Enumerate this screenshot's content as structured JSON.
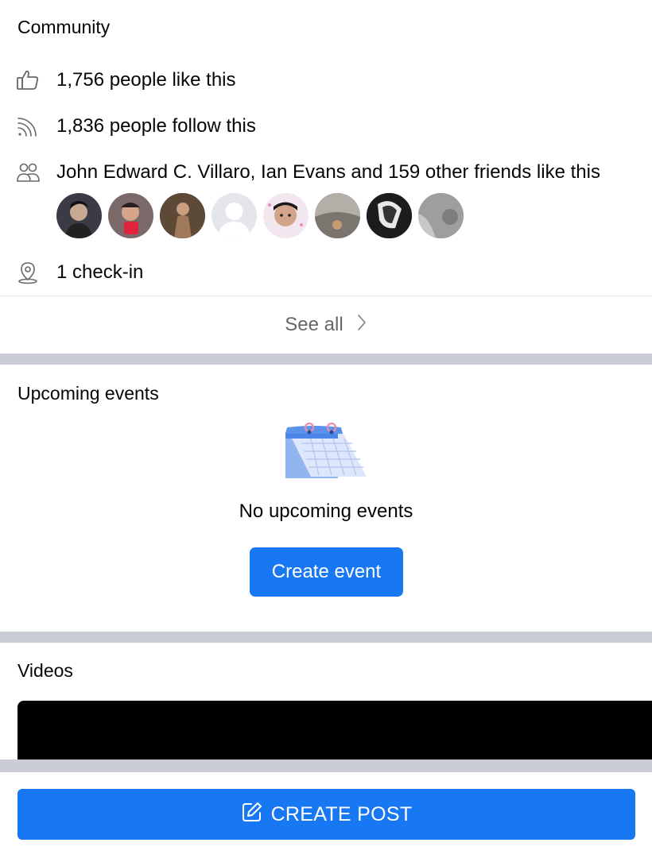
{
  "community": {
    "title": "Community",
    "likes_text": "1,756 people like this",
    "follows_text": "1,836 people follow this",
    "friends_text": "John Edward C. Villaro, Ian Evans and 159 other friends like this",
    "checkin_text": "1 check-in",
    "see_all_label": "See all",
    "friend_avatars": [
      {
        "color": "#3b3b45"
      },
      {
        "color": "#8a4a4a"
      },
      {
        "color": "#6b5541"
      },
      {
        "color": "#d9dadf"
      },
      {
        "color": "#c89a84"
      },
      {
        "color": "#8a8580"
      },
      {
        "color": "#1c1c1c"
      },
      {
        "color": "#9a9a9a"
      }
    ]
  },
  "events": {
    "title": "Upcoming events",
    "empty_text": "No upcoming events",
    "create_button_label": "Create event"
  },
  "videos": {
    "title": "Videos"
  },
  "footer": {
    "create_post_label": "CREATE POST"
  },
  "colors": {
    "accent": "#1877f2",
    "band": "#cacdd3",
    "secondary_text": "#65676b"
  }
}
